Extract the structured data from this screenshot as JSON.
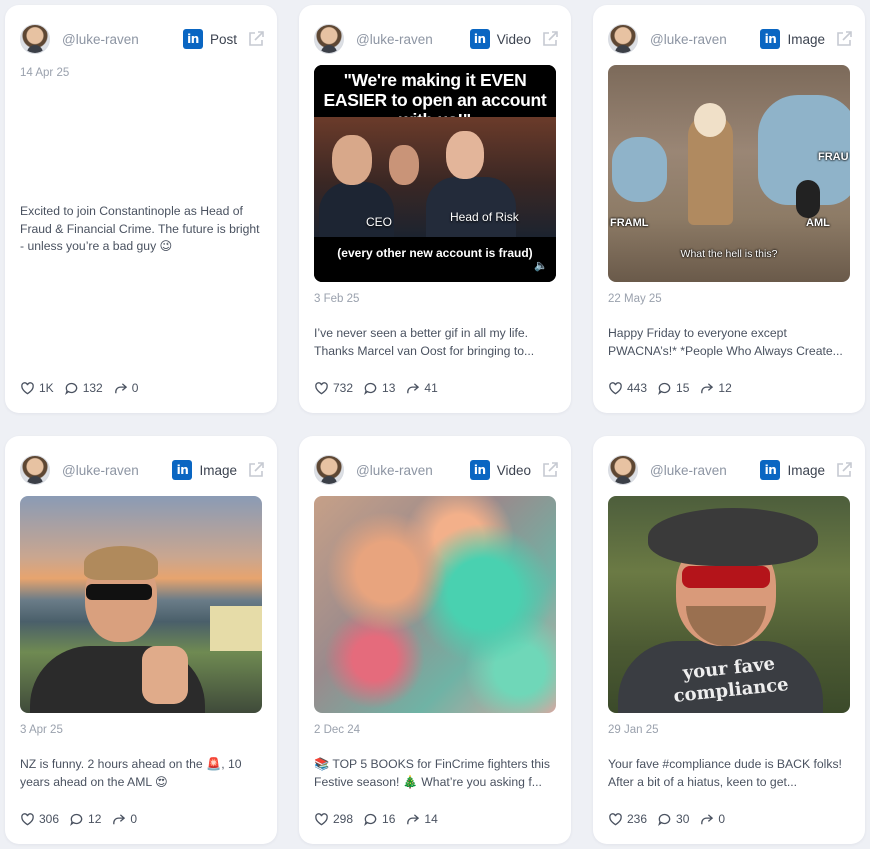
{
  "colors": {
    "background": "#eef0f5",
    "card": "#ffffff",
    "linkedin": "#0a66c2",
    "muted": "#9aa1ad"
  },
  "cards": [
    {
      "handle": "@luke-raven",
      "network_icon": "linkedin-icon",
      "type": "Post",
      "date": "14 Apr 25",
      "caption": "Excited to join Constantinople as Head of Fraud & Financial Crime. The future is bright - unless you’re a bad guy 😉",
      "likes": "1K",
      "comments": "132",
      "shares": "0"
    },
    {
      "handle": "@luke-raven",
      "network_icon": "linkedin-icon",
      "type": "Video",
      "date": "3 Feb 25",
      "media": {
        "top_text": "\"We're making it EVEN EASIER to open an account with us!\"",
        "label_left": "CEO",
        "label_right": "Head of Risk",
        "bottom_text": "(every other new account is fraud)"
      },
      "caption": "I’ve never seen a better gif in all my life. Thanks Marcel van Oost for bringing to...",
      "likes": "732",
      "comments": "13",
      "shares": "41"
    },
    {
      "handle": "@luke-raven",
      "network_icon": "linkedin-icon",
      "type": "Image",
      "date": "22 May 25",
      "media": {
        "label_left": "FRAML",
        "label_right": "AML",
        "label_top": "FRAU",
        "subtitle": "What the hell is this?"
      },
      "caption": "Happy Friday to everyone except PWACNA’s!* *People Who Always Create...",
      "likes": "443",
      "comments": "15",
      "shares": "12"
    },
    {
      "handle": "@luke-raven",
      "network_icon": "linkedin-icon",
      "type": "Image",
      "date": "3 Apr 25",
      "caption": "NZ is funny. 2 hours ahead on the 🚨, 10 years ahead on the AML 😍",
      "likes": "306",
      "comments": "12",
      "shares": "0"
    },
    {
      "handle": "@luke-raven",
      "network_icon": "linkedin-icon",
      "type": "Video",
      "date": "2 Dec 24",
      "caption": "📚 TOP 5 BOOKS for FinCrime fighters this Festive season! 🎄 What’re you asking f...",
      "likes": "298",
      "comments": "16",
      "shares": "14"
    },
    {
      "handle": "@luke-raven",
      "network_icon": "linkedin-icon",
      "type": "Image",
      "date": "29 Jan 25",
      "media": {
        "shirt_text": "your fave compliance"
      },
      "caption": "Your fave #compliance dude is BACK folks! After a bit of a hiatus, keen to get...",
      "likes": "236",
      "comments": "30",
      "shares": "0"
    }
  ]
}
